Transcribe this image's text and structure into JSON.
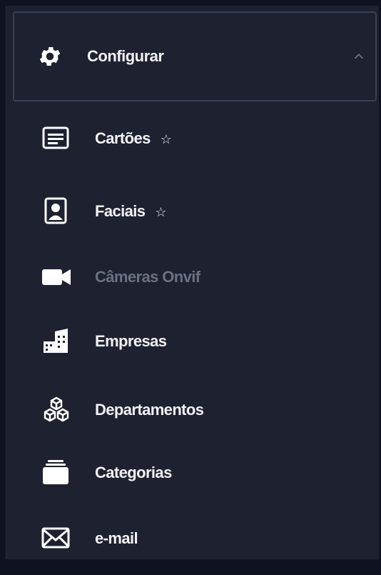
{
  "header": {
    "title": "Configurar",
    "icon": "gear-icon",
    "expanded": true
  },
  "items": [
    {
      "label": "Cartões",
      "icon": "card-icon",
      "favorite_icon": "star-outline-icon",
      "enabled": true
    },
    {
      "label": "Faciais",
      "icon": "face-id-icon",
      "favorite_icon": "star-outline-icon",
      "enabled": true
    },
    {
      "label": "Câmeras Onvif",
      "icon": "video-camera-icon",
      "enabled": false
    },
    {
      "label": "Empresas",
      "icon": "buildings-icon",
      "enabled": true
    },
    {
      "label": "Departamentos",
      "icon": "cubes-icon",
      "enabled": true
    },
    {
      "label": "Categorias",
      "icon": "folder-stack-icon",
      "enabled": true
    },
    {
      "label": "e-mail",
      "icon": "envelope-icon",
      "enabled": true
    }
  ],
  "colors": {
    "background": "#1d2130",
    "text": "#f1f2f5",
    "disabled_text": "#6c7182",
    "border": "#3a4056"
  },
  "star_glyph": "☆"
}
